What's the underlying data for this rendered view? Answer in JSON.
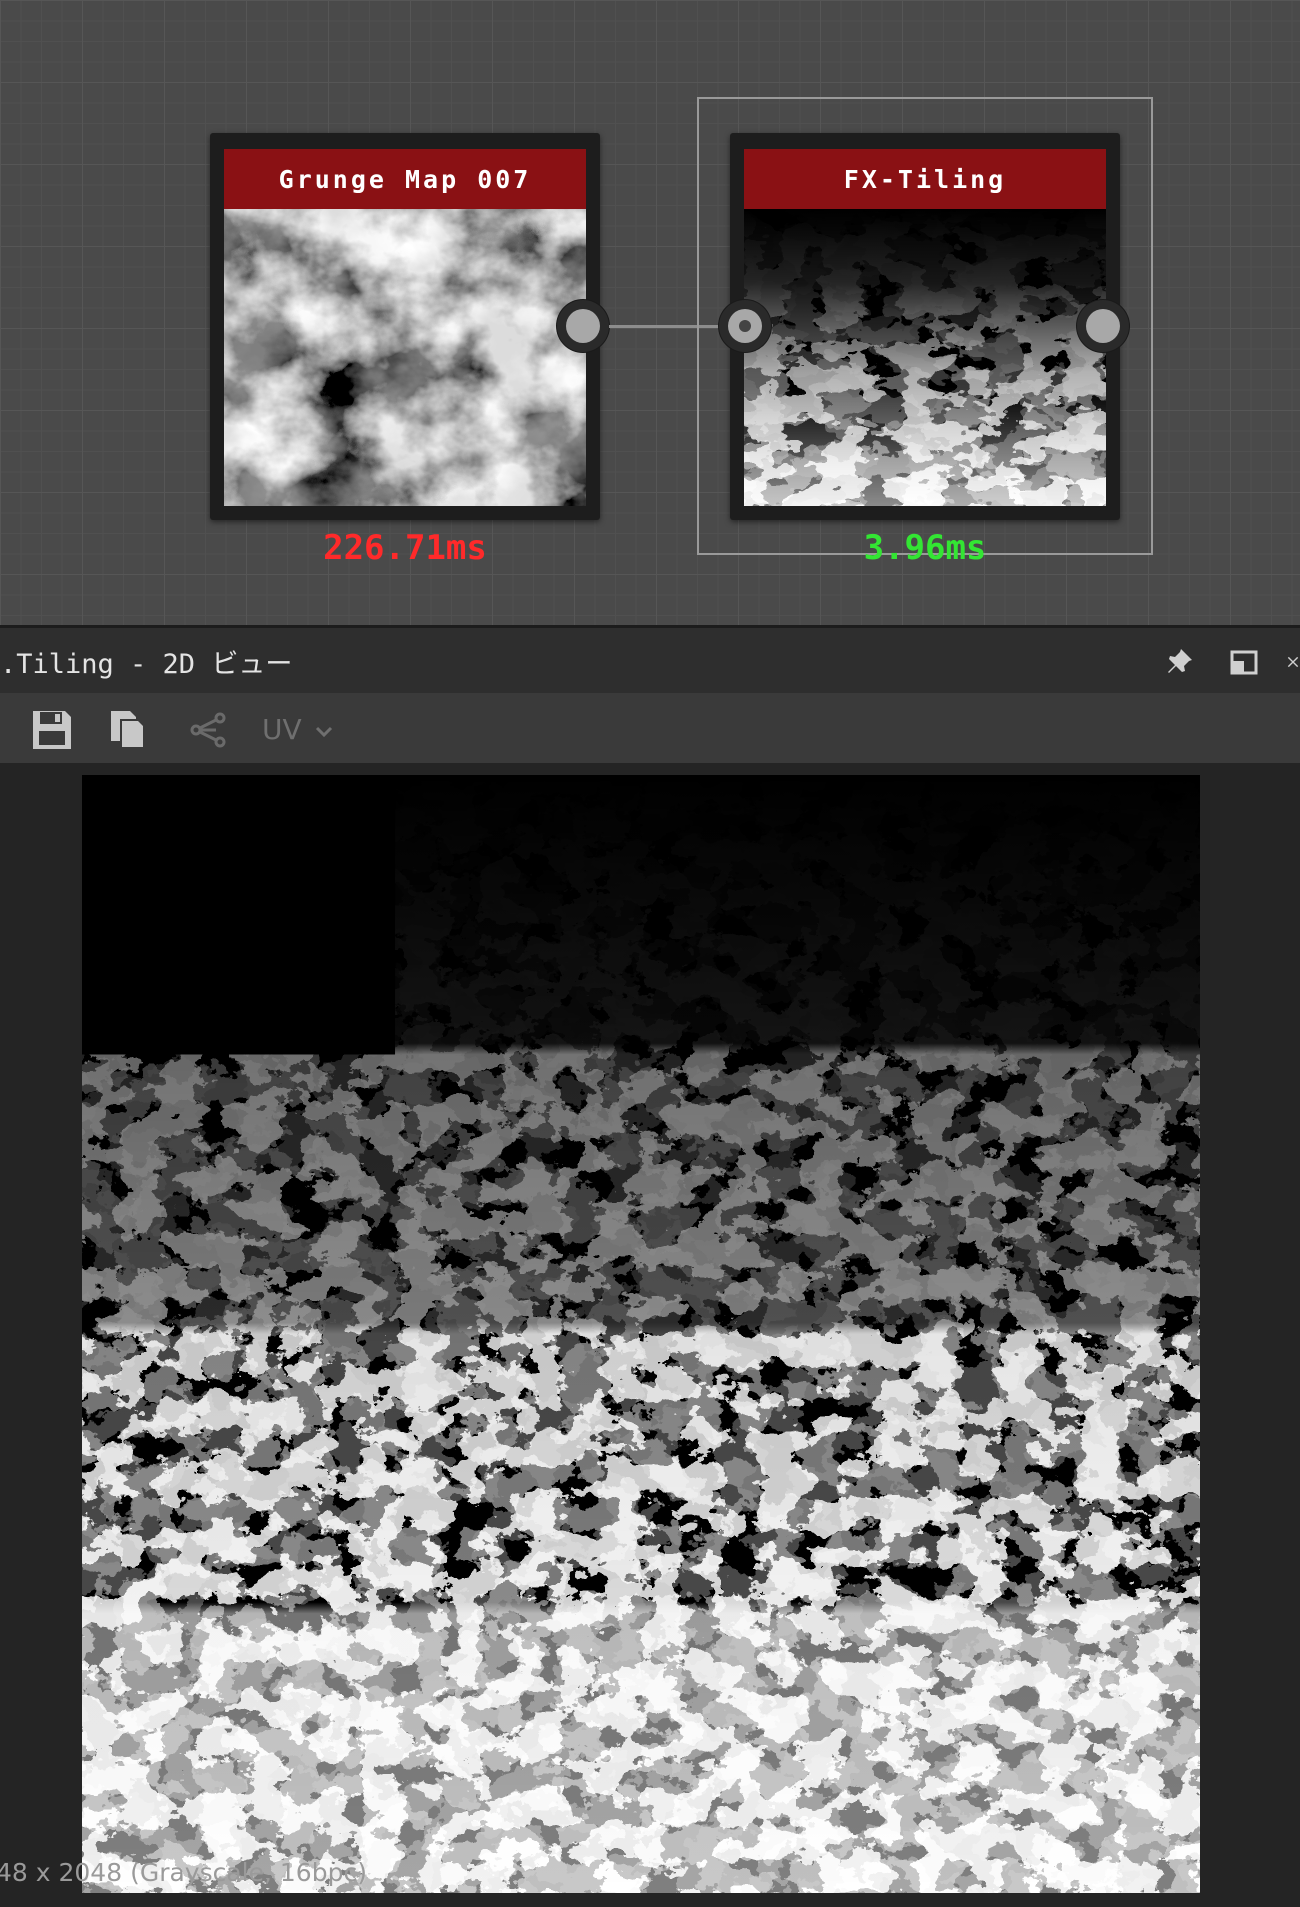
{
  "graph": {
    "nodes": [
      {
        "title": "Grunge Map 007",
        "timing": "226.71ms",
        "timing_color": "#ff2a2a"
      },
      {
        "title": "FX-Tiling",
        "timing": "3.96ms",
        "timing_color": "#33e633"
      }
    ]
  },
  "view_panel": {
    "title": ".Tiling - 2D ビュー",
    "title_icons": [
      "pin-icon",
      "maximize-icon",
      "close-icon"
    ],
    "toolbar": {
      "buttons": [
        "save-icon",
        "copy-icon",
        "share-icon"
      ],
      "uv_label": "UV",
      "uv_icon": "chevron-down-icon"
    },
    "resolution_text": "48 x 2048 (Grayscale, 16bpc)"
  },
  "colors": {
    "node_header": "#8a1114",
    "graph_bg": "#4a4a4a",
    "panel_bg": "#2e2e2e",
    "viewport_bg": "#242424"
  }
}
